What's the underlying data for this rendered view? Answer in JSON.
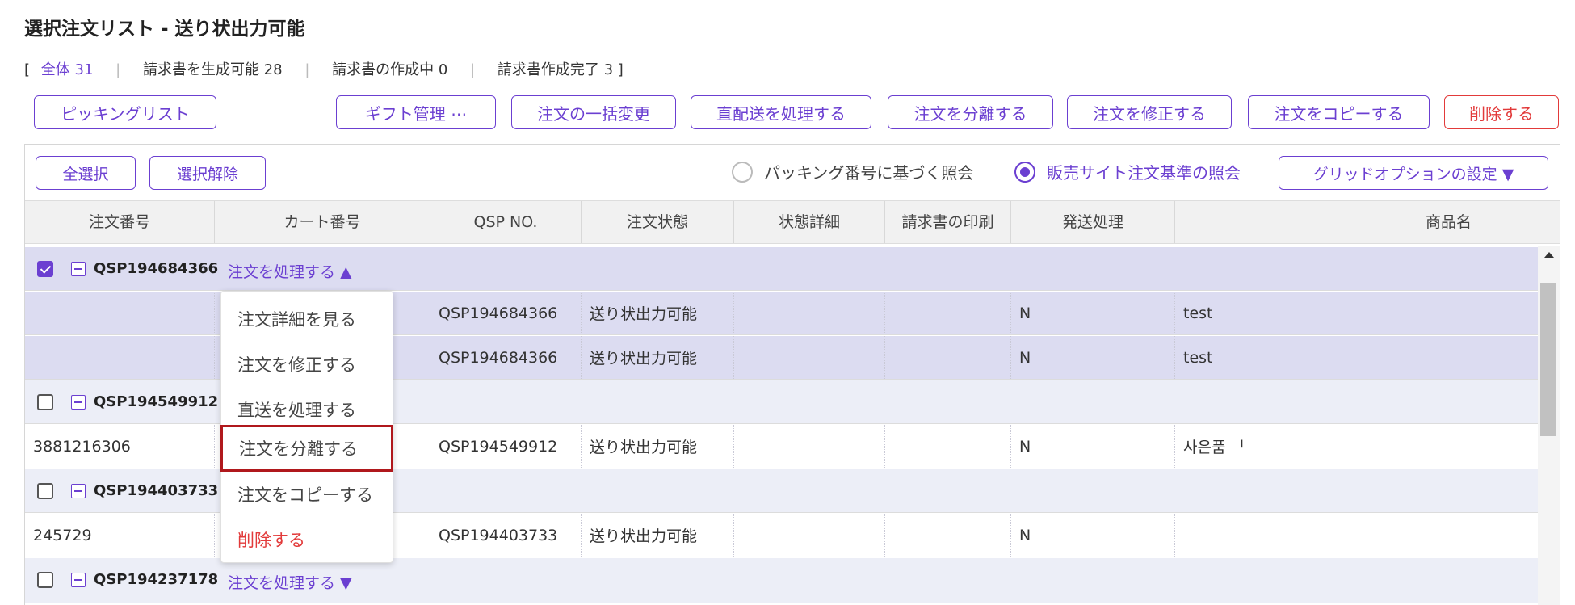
{
  "title": "選択注文リスト - 送り状出力可能",
  "tabs": {
    "open": "[",
    "all": "全体 31",
    "billable": "請求書を生成可能 28",
    "creating": "請求書の作成中 0",
    "done": "請求書作成完了 3",
    "close": "]"
  },
  "toolbar": {
    "picking": "ピッキングリスト",
    "gift": "ギフト管理 ⋯",
    "bulk_change": "注文の一括変更",
    "direct": "直配送を処理する",
    "split": "注文を分離する",
    "modify": "注文を修正する",
    "copy": "注文をコピーする",
    "delete": "削除する"
  },
  "panel": {
    "select_all": "全選択",
    "deselect": "選択解除",
    "radio_packing": "パッキング番号に基づく照会",
    "radio_site": "販売サイト注文基準の照会",
    "grid_options": "グリッドオプションの設定 ▼"
  },
  "columns": [
    "注文番号",
    "カート番号",
    "QSP NO.",
    "注文状態",
    "状態詳細",
    "請求書の印刷",
    "発送処理",
    "商品名"
  ],
  "groups": [
    {
      "order_no": "QSP194684366",
      "action": "注文を処理する ▲",
      "checked": true
    },
    {
      "order_no": "QSP194549912",
      "action": "",
      "checked": false
    },
    {
      "order_no": "QSP194403733",
      "action": "",
      "checked": false
    },
    {
      "order_no": "QSP194237178",
      "action": "注文を処理する ▼",
      "checked": false
    }
  ],
  "rows": [
    {
      "order": "",
      "qsp": "QSP194684366",
      "status": "送り状出力可能",
      "ship": "N",
      "product": "test"
    },
    {
      "order": "",
      "qsp": "QSP194684366",
      "status": "送り状出力可能",
      "ship": "N",
      "product": "test"
    },
    {
      "order": "3881216306",
      "qsp": "QSP194549912",
      "status": "送り状出力可能",
      "ship": "N",
      "product": "사은품 ᅵ"
    },
    {
      "order": "245729",
      "qsp": "QSP194403733",
      "status": "送り状出力可能",
      "ship": "N",
      "product": ""
    }
  ],
  "menu": {
    "view": "注文詳細を見る",
    "modify": "注文を修正する",
    "direct": "直送を処理する",
    "split": "注文を分離する",
    "copy": "注文をコピーする",
    "delete": "削除する"
  },
  "colors": {
    "accent": "#6b3fd1",
    "danger": "#e23a3a",
    "highlight": "#b0181c"
  }
}
